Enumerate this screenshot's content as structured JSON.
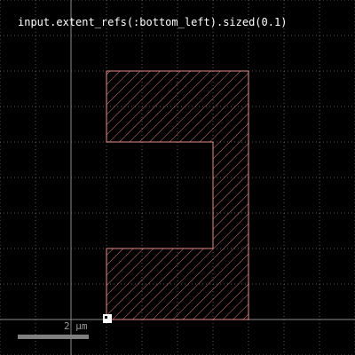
{
  "expression": "input.extent_refs(:bottom_left).sized(0.1)",
  "scale_bar": {
    "label": "2 µm"
  },
  "colors": {
    "background": "#000000",
    "grid": "#5a5a5a",
    "axis": "#8a8a8a",
    "shape_stroke": "#f08a8a",
    "hatch": "#d87a7a",
    "marker": "#ffffff",
    "text": "#ffffff",
    "scale_bar": "#808080"
  },
  "icons": {
    "origin_marker": "extent-ref-marker-icon"
  }
}
